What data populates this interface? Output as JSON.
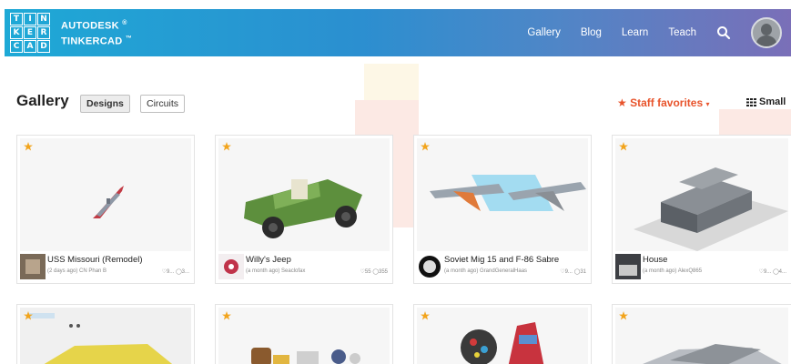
{
  "header": {
    "logo_letters": [
      "T",
      "I",
      "N",
      "K",
      "E",
      "R",
      "C",
      "A",
      "D"
    ],
    "brand_line1": "AUTODESK",
    "brand_line2": "TINKERCAD",
    "brand_mark1": "®",
    "brand_mark2": "™",
    "nav": [
      "Gallery",
      "Blog",
      "Learn",
      "Teach"
    ],
    "search_icon": "search-icon",
    "avatar_icon": "user-avatar"
  },
  "toolbar": {
    "title": "Gallery",
    "tabs": [
      "Designs",
      "Circuits"
    ],
    "active_tab": "Designs",
    "sort_label": "Staff favorites",
    "view_label": "Small",
    "accent_color": "#e8542c"
  },
  "cards": [
    {
      "title": "USS Missouri (Remodel)",
      "meta": "(2 days ago) CN Phan B",
      "stats": "♡9... ◯3..."
    },
    {
      "title": "Willy's Jeep",
      "meta": "(a month ago) Seaclofax",
      "stats": "♡55 ◯355"
    },
    {
      "title": "Soviet Mig 15 and F-86 Sabre",
      "meta": "(a month ago) GrandGeneralHaas",
      "stats": "♡9... ◯31"
    },
    {
      "title": "House",
      "meta": "(a month ago) AlexQ865",
      "stats": "♡9... ◯4..."
    },
    {
      "title": ""
    },
    {
      "title": ""
    },
    {
      "title": ""
    },
    {
      "title": ""
    }
  ]
}
